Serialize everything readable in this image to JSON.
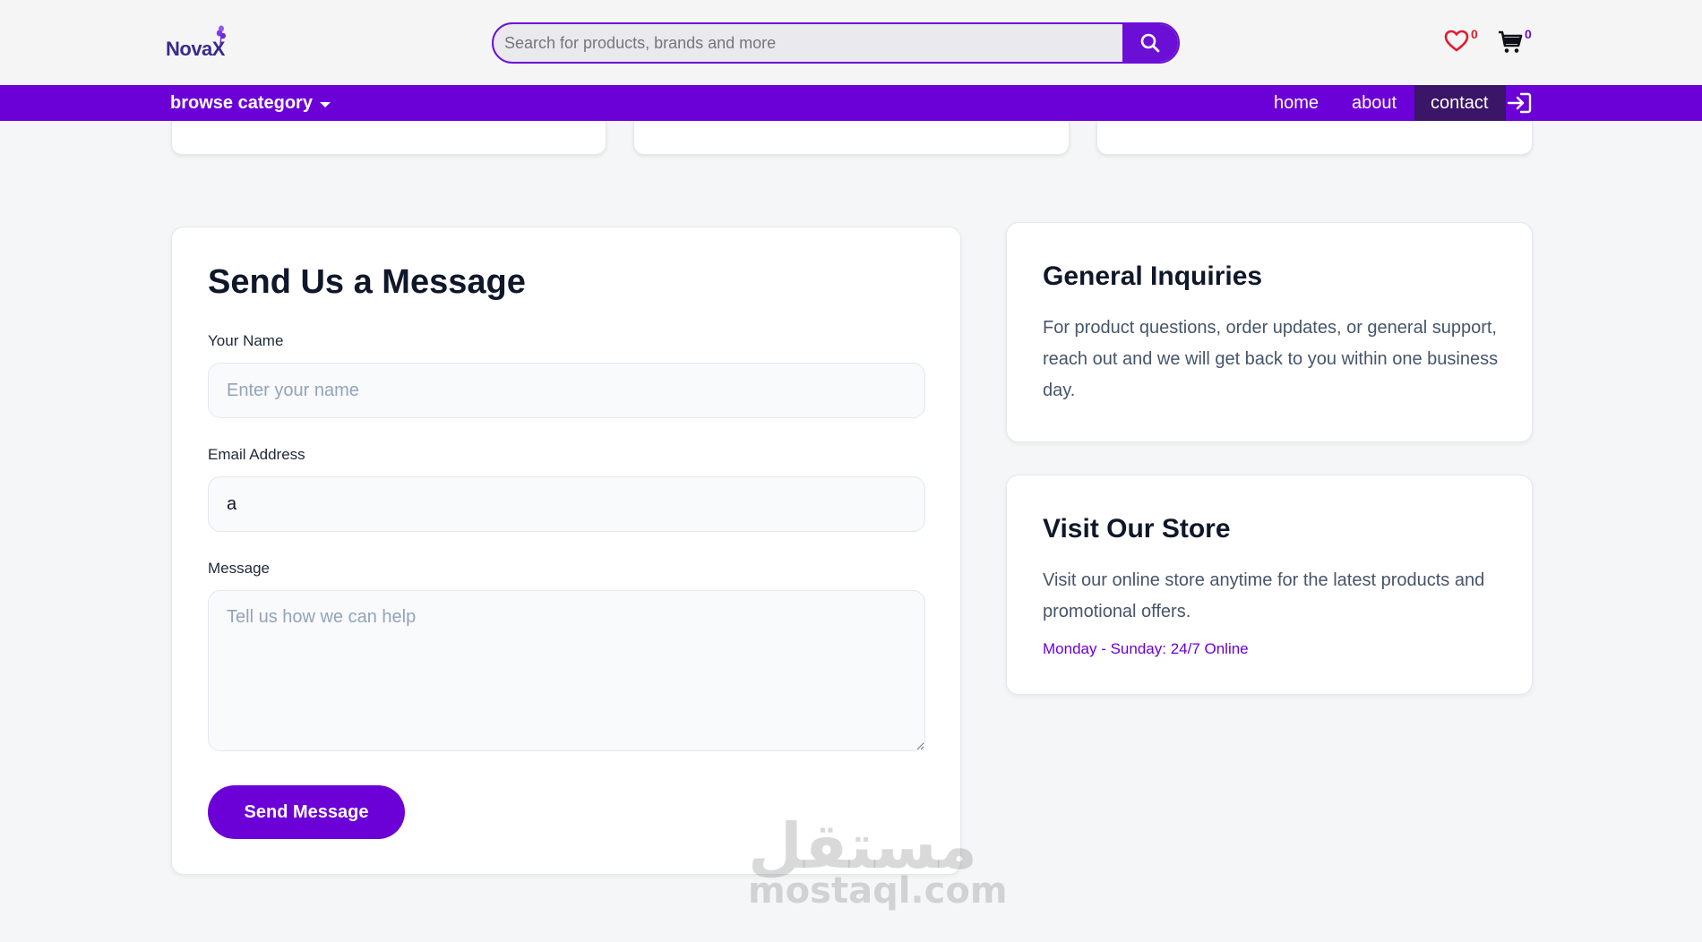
{
  "header": {
    "logo_text": "NovaX",
    "search_placeholder": "Search for products, brands and more",
    "wishlist_count": "0",
    "cart_count": "0"
  },
  "nav": {
    "browse_label": "browse category",
    "links": [
      {
        "label": "home"
      },
      {
        "label": "about"
      },
      {
        "label": "contact"
      }
    ]
  },
  "form": {
    "title": "Send Us a Message",
    "name_label": "Your Name",
    "name_placeholder": "Enter your name",
    "email_label": "Email Address",
    "email_value": "a",
    "message_label": "Message",
    "message_placeholder": "Tell us how we can help",
    "submit_label": "Send Message"
  },
  "info": {
    "general_title": "General Inquiries",
    "general_text": "For product questions, order updates, or general support, reach out and we will get back to you within one business day.",
    "store_title": "Visit Our Store",
    "store_text": "Visit our online store anytime for the latest products and promotional offers.",
    "store_hours": "Monday - Sunday: 24/7 Online"
  },
  "watermark": {
    "arabic": "مستقل",
    "latin": "mostaql.com"
  },
  "colors": {
    "brand": "#6b00d7",
    "active_nav": "#3a1568",
    "wishlist": "#e11d2e"
  }
}
